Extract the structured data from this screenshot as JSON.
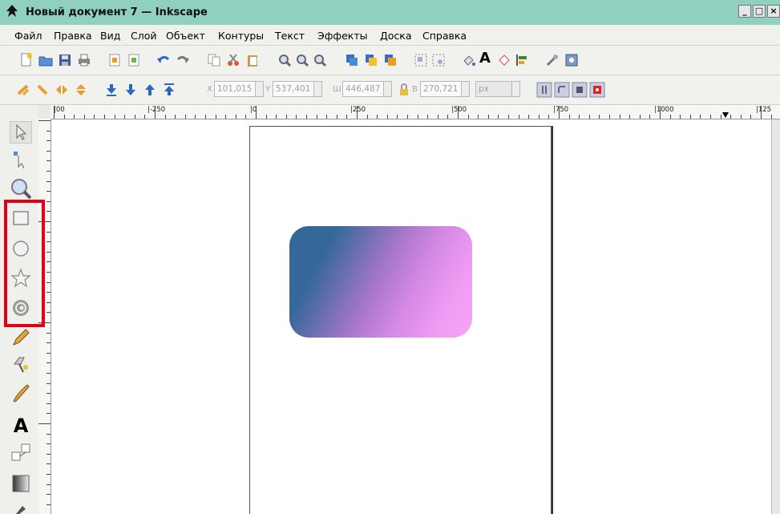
{
  "window": {
    "title": "Новый документ 7 — Inkscape",
    "buttons": {
      "minimize": "_",
      "maximize": "□",
      "close": "×"
    }
  },
  "menu": [
    "Файл",
    "Правка",
    "Вид",
    "Слой",
    "Объект",
    "Контуры",
    "Текст",
    "Эффекты",
    "Доска",
    "Справка"
  ],
  "toolbar2": {
    "x_label": "X",
    "x_value": "101,015",
    "y_label": "Y",
    "y_value": "537,401",
    "w_label": "Ш",
    "w_value": "446,487",
    "h_label": "В",
    "h_value": "270,721",
    "units_value": "px"
  },
  "ruler": {
    "labels": [
      "|00",
      "|-250",
      "|0",
      "|250",
      "|500",
      "|750",
      "|1000",
      "|125"
    ]
  },
  "toolbox": [
    "selector-tool",
    "node-tool",
    "zoom-tool",
    "rectangle-tool",
    "ellipse-tool",
    "star-tool",
    "spiral-tool",
    "pencil-tool",
    "pen-tool",
    "calligraphy-tool",
    "text-tool",
    "connector-tool",
    "gradient-tool",
    "dropper-tool"
  ],
  "highlight_color": "#e0001a",
  "gradient_colors": [
    "#356899",
    "#f4a4f6"
  ]
}
